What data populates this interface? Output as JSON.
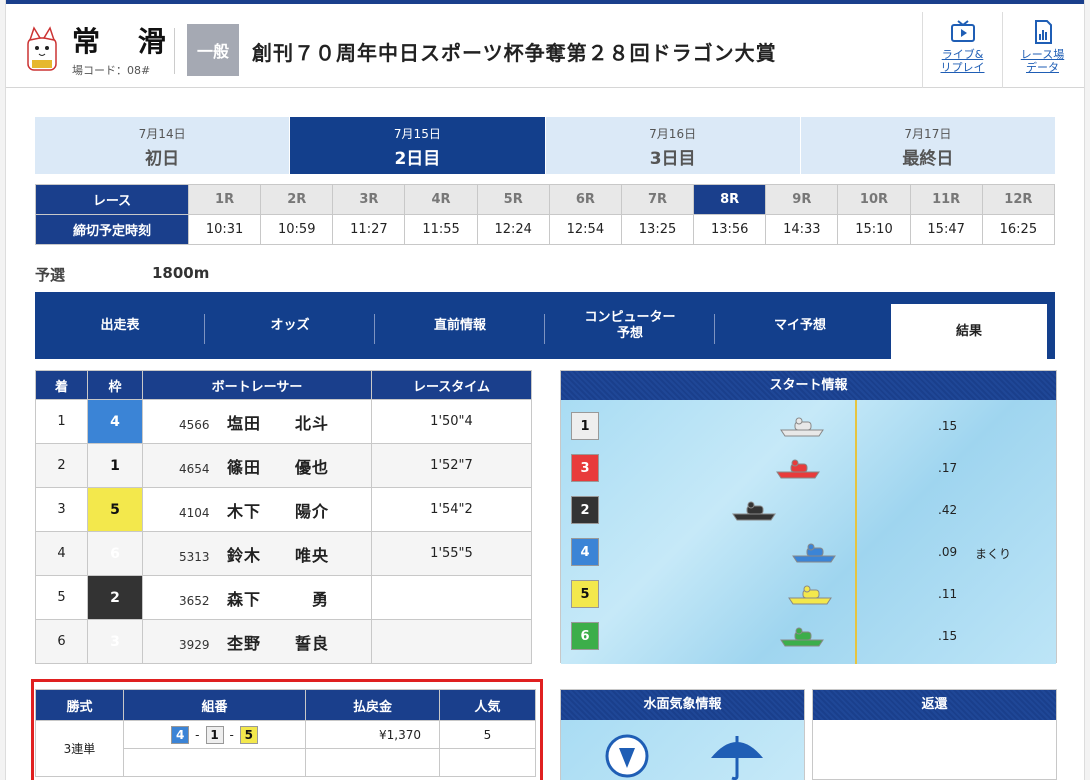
{
  "header": {
    "venue_name": "常 滑",
    "venue_code": "場コード：08#",
    "grade": "一般",
    "race_title": "創刊７０周年中日スポーツ杯争奪第２８回ドラゴン大賞",
    "live_label_1": "ライブ&",
    "live_label_2": "リプレイ",
    "data_label_1": "レース場",
    "data_label_2": "データ"
  },
  "days": [
    {
      "date": "7月14日",
      "name": "初日",
      "active": false
    },
    {
      "date": "7月15日",
      "name": "2日目",
      "active": true
    },
    {
      "date": "7月16日",
      "name": "3日目",
      "active": false
    },
    {
      "date": "7月17日",
      "name": "最終日",
      "active": false
    }
  ],
  "race_table": {
    "race_header": "レース",
    "time_header": "締切予定時刻",
    "races": [
      "1R",
      "2R",
      "3R",
      "4R",
      "5R",
      "6R",
      "7R",
      "8R",
      "9R",
      "10R",
      "11R",
      "12R"
    ],
    "times": [
      "10:31",
      "10:59",
      "11:27",
      "11:55",
      "12:24",
      "12:54",
      "13:25",
      "13:56",
      "14:33",
      "15:10",
      "15:47",
      "16:25"
    ],
    "selected": "8R"
  },
  "race_info": {
    "class": "予選",
    "distance": "1800m"
  },
  "tabs": [
    {
      "label": "出走表"
    },
    {
      "label": "オッズ"
    },
    {
      "label": "直前情報"
    },
    {
      "label_1": "コンピューター",
      "label_2": "予想"
    },
    {
      "label": "マイ予想"
    },
    {
      "label": "結果",
      "active": true
    }
  ],
  "results": {
    "headers": [
      "着",
      "枠",
      "ボートレーサー",
      "レースタイム"
    ],
    "rows": [
      {
        "rank": "1",
        "waku": "4",
        "id": "4566",
        "name": "塩田　　北斗",
        "time": "1'50\"4"
      },
      {
        "rank": "2",
        "waku": "1",
        "id": "4654",
        "name": "篠田　　優也",
        "time": "1'52\"7"
      },
      {
        "rank": "3",
        "waku": "5",
        "id": "4104",
        "name": "木下　　陽介",
        "time": "1'54\"2"
      },
      {
        "rank": "4",
        "waku": "6",
        "id": "5313",
        "name": "鈴木　　唯央",
        "time": "1'55\"5"
      },
      {
        "rank": "5",
        "waku": "2",
        "id": "3652",
        "name": "森下　　　勇",
        "time": ""
      },
      {
        "rank": "6",
        "waku": "3",
        "id": "3929",
        "name": "杢野　　誓良",
        "time": ""
      }
    ]
  },
  "start_info": {
    "title": "スタート情報",
    "rows": [
      {
        "waku": "1",
        "st": ".15",
        "note": "",
        "boat_color": "#e8e8e8"
      },
      {
        "waku": "3",
        "st": ".17",
        "note": "",
        "boat_color": "#e83b3b"
      },
      {
        "waku": "2",
        "st": ".42",
        "note": "",
        "boat_color": "#333333"
      },
      {
        "waku": "4",
        "st": ".09",
        "note": "まくり",
        "boat_color": "#3b84d6"
      },
      {
        "waku": "5",
        "st": ".11",
        "note": "",
        "boat_color": "#f3e84c"
      },
      {
        "waku": "6",
        "st": ".15",
        "note": "",
        "boat_color": "#3cae4a"
      }
    ]
  },
  "payout": {
    "headers": [
      "勝式",
      "組番",
      "払戻金",
      "人気"
    ],
    "type": "3連単",
    "combo": [
      "4",
      "1",
      "5"
    ],
    "amount": "¥1,370",
    "popularity": "5"
  },
  "weather": {
    "title": "水面気象情報",
    "wind_icon": "wind-direction-icon",
    "weather_icon": "rain-umbrella-icon"
  },
  "refund": {
    "title": "返還"
  }
}
